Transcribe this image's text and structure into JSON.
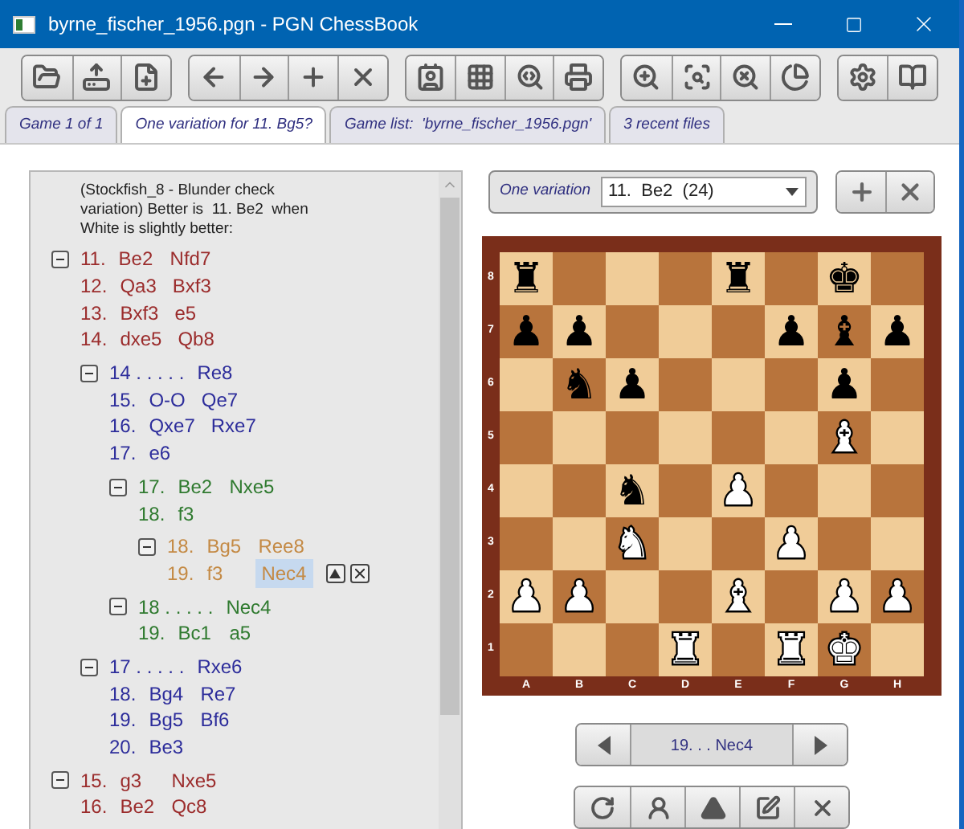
{
  "window": {
    "title": "byrne_fischer_1956.pgn - PGN ChessBook"
  },
  "tabs": [
    {
      "label": "Game 1 of 1",
      "selected": false
    },
    {
      "label": "One variation for 11. Bg5?",
      "selected": true
    },
    {
      "label": "Game list:  'byrne_fischer_1956.pgn'",
      "selected": false
    },
    {
      "label": "3 recent files",
      "selected": false
    }
  ],
  "tree": {
    "comment": "(Stockfish_8 - Blunder check variation) Better is  11. Be2  when White is slightly better:",
    "variations": [
      {
        "expanded": true,
        "lines": [
          {
            "number": "11.",
            "moves": [
              {
                "san": "Be2",
                "selected": false
              },
              {
                "san": "Nfd7",
                "selected": false
              }
            ]
          },
          {
            "number": "12.",
            "moves": [
              {
                "san": "Qa3",
                "selected": false
              },
              {
                "san": "Bxf3",
                "selected": false
              }
            ]
          },
          {
            "number": "13.",
            "moves": [
              {
                "san": "Bxf3",
                "selected": false
              },
              {
                "san": "e5",
                "selected": false
              }
            ]
          },
          {
            "number": "14.",
            "moves": [
              {
                "san": "dxe5",
                "selected": false
              },
              {
                "san": "Qb8",
                "selected": false
              }
            ]
          }
        ],
        "children": [
          {
            "expanded": true,
            "lines": [
              {
                "number": "14 . . . . .",
                "moves": [
                  {
                    "san": "Re8",
                    "selected": false
                  }
                ]
              },
              {
                "number": "15.",
                "moves": [
                  {
                    "san": "O-O",
                    "selected": false
                  },
                  {
                    "san": "Qe7",
                    "selected": false
                  }
                ]
              },
              {
                "number": "16.",
                "moves": [
                  {
                    "san": "Qxe7",
                    "selected": false
                  },
                  {
                    "san": "Rxe7",
                    "selected": false
                  }
                ]
              },
              {
                "number": "17.",
                "moves": [
                  {
                    "san": "e6",
                    "selected": false
                  }
                ]
              }
            ],
            "children": [
              {
                "expanded": true,
                "lines": [
                  {
                    "number": "17.",
                    "moves": [
                      {
                        "san": "Be2",
                        "selected": false
                      },
                      {
                        "san": "Nxe5",
                        "selected": false
                      }
                    ]
                  },
                  {
                    "number": "18.",
                    "moves": [
                      {
                        "san": "f3",
                        "selected": false
                      }
                    ]
                  }
                ],
                "children": [
                  {
                    "expanded": true,
                    "lines": [
                      {
                        "number": "18.",
                        "moves": [
                          {
                            "san": "Bg5",
                            "selected": false
                          },
                          {
                            "san": "Ree8",
                            "selected": false
                          }
                        ]
                      },
                      {
                        "number": "19.",
                        "moves": [
                          {
                            "san": "f3",
                            "selected": false
                          },
                          {
                            "san": "Nec4",
                            "selected": true
                          }
                        ]
                      }
                    ]
                  }
                ]
              },
              {
                "expanded": true,
                "lines": [
                  {
                    "number": "18 . . . . .",
                    "moves": [
                      {
                        "san": "Nec4",
                        "selected": false
                      }
                    ]
                  },
                  {
                    "number": "19.",
                    "moves": [
                      {
                        "san": "Bc1",
                        "selected": false
                      },
                      {
                        "san": "a5",
                        "selected": false
                      }
                    ]
                  }
                ]
              }
            ]
          },
          {
            "expanded": true,
            "lines": [
              {
                "number": "17 . . . . .",
                "moves": [
                  {
                    "san": "Rxe6",
                    "selected": false
                  }
                ]
              },
              {
                "number": "18.",
                "moves": [
                  {
                    "san": "Bg4",
                    "selected": false
                  },
                  {
                    "san": "Re7",
                    "selected": false
                  }
                ]
              },
              {
                "number": "19.",
                "moves": [
                  {
                    "san": "Bg5",
                    "selected": false
                  },
                  {
                    "san": "Bf6",
                    "selected": false
                  }
                ]
              },
              {
                "number": "20.",
                "moves": [
                  {
                    "san": "Be3",
                    "selected": false
                  }
                ]
              }
            ]
          }
        ]
      },
      {
        "expanded": true,
        "lines": [
          {
            "number": "15.",
            "moves": [
              {
                "san": "g3",
                "selected": false
              },
              {
                "san": "Nxe5",
                "selected": false
              }
            ]
          },
          {
            "number": "16.",
            "moves": [
              {
                "san": "Be2",
                "selected": false
              },
              {
                "san": "Qc8",
                "selected": false
              }
            ]
          }
        ]
      }
    ]
  },
  "variation_picker": {
    "label": "One variation",
    "value": "11.  Be2  (24)"
  },
  "board": {
    "ranks": [
      "8",
      "7",
      "6",
      "5",
      "4",
      "3",
      "2",
      "1"
    ],
    "files": [
      "A",
      "B",
      "C",
      "D",
      "E",
      "F",
      "G",
      "H"
    ],
    "rows": [
      [
        {
          "kind": "black",
          "piece": "♜"
        },
        {
          "kind": "empty"
        },
        {
          "kind": "empty"
        },
        {
          "kind": "empty"
        },
        {
          "kind": "black",
          "piece": "♜"
        },
        {
          "kind": "empty"
        },
        {
          "kind": "black",
          "piece": "♚"
        },
        {
          "kind": "empty"
        }
      ],
      [
        {
          "kind": "black",
          "piece": "♟"
        },
        {
          "kind": "black",
          "piece": "♟"
        },
        {
          "kind": "empty"
        },
        {
          "kind": "empty"
        },
        {
          "kind": "empty"
        },
        {
          "kind": "black",
          "piece": "♟"
        },
        {
          "kind": "black",
          "piece": "♝"
        },
        {
          "kind": "black",
          "piece": "♟"
        }
      ],
      [
        {
          "kind": "empty"
        },
        {
          "kind": "black",
          "piece": "♞"
        },
        {
          "kind": "black",
          "piece": "♟"
        },
        {
          "kind": "empty"
        },
        {
          "kind": "empty"
        },
        {
          "kind": "empty"
        },
        {
          "kind": "black",
          "piece": "♟"
        },
        {
          "kind": "empty"
        }
      ],
      [
        {
          "kind": "empty"
        },
        {
          "kind": "empty"
        },
        {
          "kind": "empty"
        },
        {
          "kind": "empty"
        },
        {
          "kind": "empty"
        },
        {
          "kind": "empty"
        },
        {
          "kind": "white",
          "piece": "♝"
        },
        {
          "kind": "empty"
        }
      ],
      [
        {
          "kind": "empty"
        },
        {
          "kind": "empty"
        },
        {
          "kind": "black",
          "piece": "♞"
        },
        {
          "kind": "empty"
        },
        {
          "kind": "white",
          "piece": "♟"
        },
        {
          "kind": "empty"
        },
        {
          "kind": "empty"
        },
        {
          "kind": "empty"
        }
      ],
      [
        {
          "kind": "empty"
        },
        {
          "kind": "empty"
        },
        {
          "kind": "white",
          "piece": "♞"
        },
        {
          "kind": "empty"
        },
        {
          "kind": "empty"
        },
        {
          "kind": "white",
          "piece": "♟"
        },
        {
          "kind": "empty"
        },
        {
          "kind": "empty"
        }
      ],
      [
        {
          "kind": "white",
          "piece": "♟"
        },
        {
          "kind": "white",
          "piece": "♟"
        },
        {
          "kind": "empty"
        },
        {
          "kind": "empty"
        },
        {
          "kind": "white",
          "piece": "♝"
        },
        {
          "kind": "empty"
        },
        {
          "kind": "white",
          "piece": "♟"
        },
        {
          "kind": "white",
          "piece": "♟"
        }
      ],
      [
        {
          "kind": "empty"
        },
        {
          "kind": "empty"
        },
        {
          "kind": "empty"
        },
        {
          "kind": "white",
          "piece": "♜"
        },
        {
          "kind": "empty"
        },
        {
          "kind": "white",
          "piece": "♜"
        },
        {
          "kind": "white",
          "piece": "♚"
        },
        {
          "kind": "empty"
        }
      ]
    ]
  },
  "navigator": {
    "move": "19. . . Nec4"
  }
}
